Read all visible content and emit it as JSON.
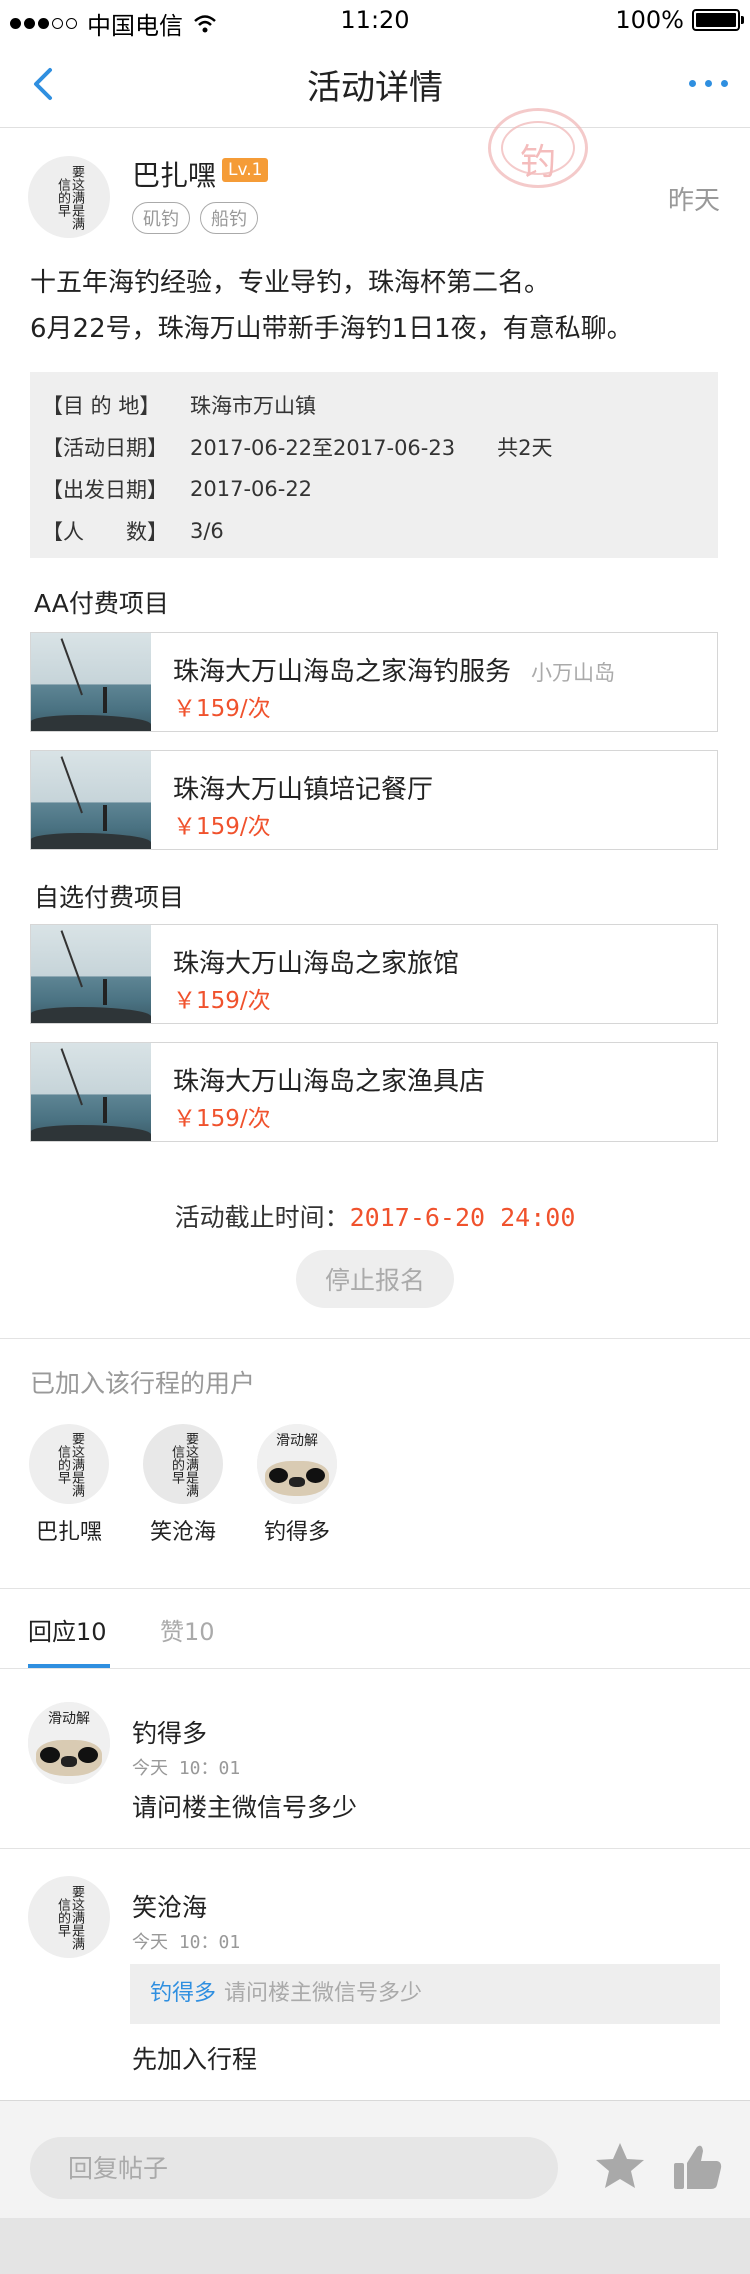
{
  "status_bar": {
    "carrier": "中国电信",
    "time": "11:20",
    "battery": "100%"
  },
  "nav": {
    "title": "活动详情",
    "back_icon": "back-chevron-icon",
    "more_icon": "more-dots-icon",
    "accent": "#2f8fe0"
  },
  "post": {
    "author": "巴扎嘿",
    "level": "Lv.1",
    "tags": [
      "矶钓",
      "船钓"
    ],
    "time": "昨天",
    "stamp_char": "钓",
    "avatar_text": "要这满是满信的早",
    "desc_lines": [
      "十五年海钓经验，专业导钓，珠海杯第二名。",
      "6月22号，珠海万山带新手海钓1日1夜，有意私聊。"
    ]
  },
  "info": [
    {
      "label": "【目 的 地】",
      "value": "珠海市万山镇"
    },
    {
      "label": "【活动日期】",
      "value": "2017-06-22至2017-06-23　　共2天"
    },
    {
      "label": "【出发日期】",
      "value": "2017-06-22"
    },
    {
      "label": "【人　　数】",
      "value": "3/6"
    }
  ],
  "aa_section": {
    "title": "AA付费项目",
    "items": [
      {
        "name": "珠海大万山海岛之家海钓服务",
        "location": "小万山岛",
        "price": "￥159/次"
      },
      {
        "name": "珠海大万山镇培记餐厅",
        "location": "",
        "price": "￥159/次"
      }
    ]
  },
  "optional_section": {
    "title": "自选付费项目",
    "items": [
      {
        "name": "珠海大万山海岛之家旅馆",
        "location": "",
        "price": "￥159/次"
      },
      {
        "name": "珠海大万山海岛之家渔具店",
        "location": "",
        "price": "￥159/次"
      }
    ]
  },
  "deadline": {
    "label": "活动截止时间：",
    "value": "2017-6-20 24:00"
  },
  "stop_button": "停止报名",
  "joined": {
    "title": "已加入该行程的用户",
    "members": [
      {
        "name": "巴扎嘿"
      },
      {
        "name": "笑沧海"
      },
      {
        "name": "钓得多"
      }
    ]
  },
  "tabs": [
    {
      "label": "回应10"
    },
    {
      "label": "赞10"
    }
  ],
  "pug_text": "滑动解",
  "comments": [
    {
      "name": "钓得多",
      "time": "今天 10：01",
      "text": "请问楼主微信号多少"
    },
    {
      "name": "笑沧海",
      "time": "今天 10：01",
      "quote_name": "钓得多",
      "quote_text": "请问楼主微信号多少",
      "text": "先加入行程"
    }
  ],
  "bottom": {
    "placeholder": "回复帖子",
    "star_icon": "star-icon",
    "like_icon": "thumbs-up-icon"
  }
}
